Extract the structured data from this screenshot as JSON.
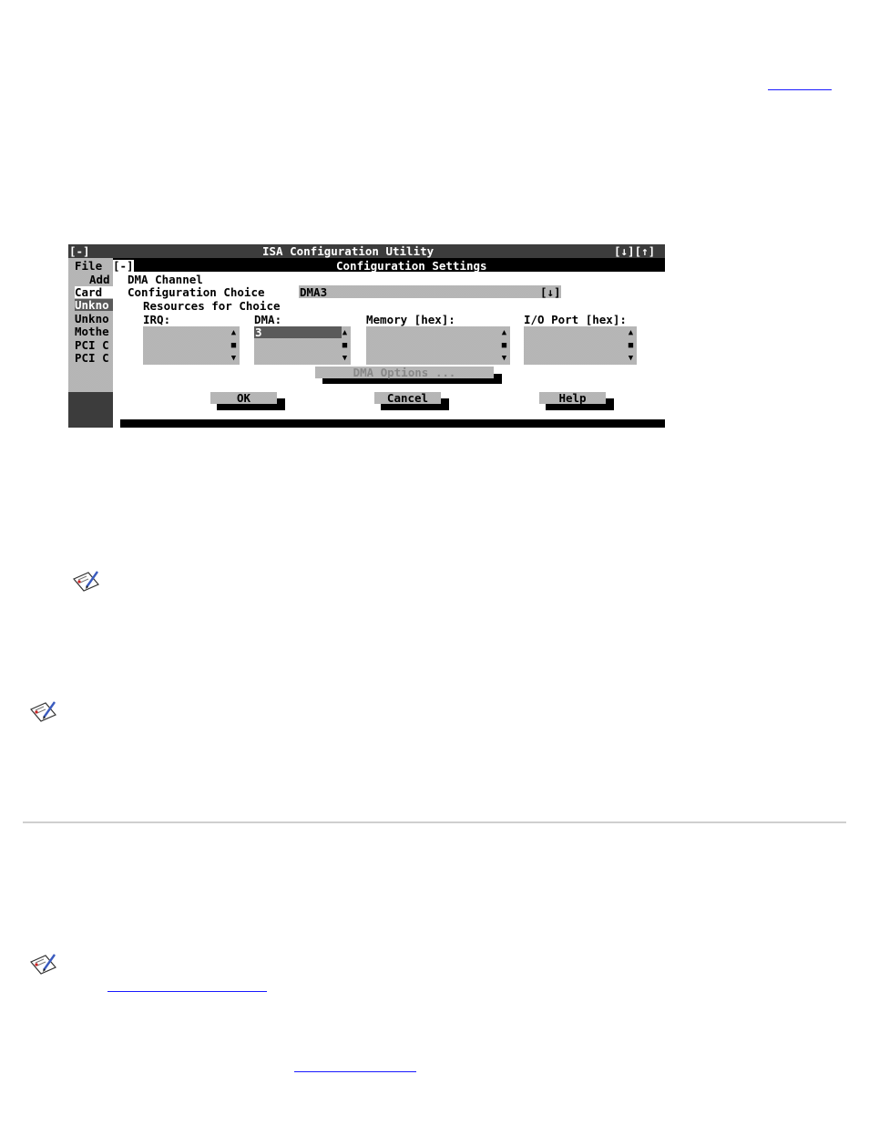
{
  "utility": {
    "window_title": "ISA Configuration Utility",
    "system_menu": "[-]",
    "scroll_controls": "[↓][↑]",
    "menu_file": "File",
    "sidebar": [
      "Add",
      "Card",
      "Unkno",
      "Unkno",
      "Mothe",
      "PCI C",
      "PCI C"
    ]
  },
  "dialog": {
    "system_menu": "[-]",
    "title": "Configuration Settings",
    "resource_label": "DMA Channel",
    "choice_label": "Configuration Choice",
    "choice_value": "DMA3",
    "choice_dropdown": "[↓]",
    "resources_label": "Resources for Choice",
    "columns": {
      "irq_label": "IRQ:",
      "dma_label": "DMA:",
      "dma_value": "3",
      "memory_label": "Memory [hex]:",
      "io_label": "I/O Port [hex]:"
    },
    "options_button": "DMA Options ...",
    "buttons": {
      "ok": "OK",
      "cancel": "Cancel",
      "help": "Help"
    }
  },
  "colors": {
    "link": "#1a1aff",
    "rule": "#cfcfcf",
    "highlight": "#5a5a5a"
  }
}
